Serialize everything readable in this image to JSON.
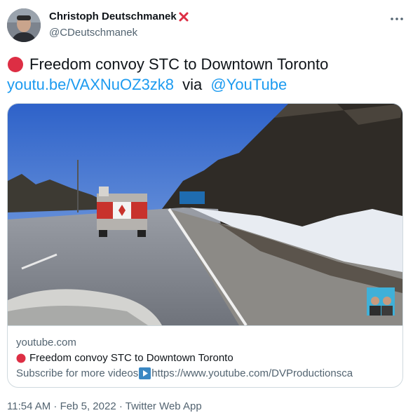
{
  "author": {
    "display_name": "Christoph Deutschmanek",
    "handle": "@CDeutschmanek",
    "name_emoji": "cross-mark-icon"
  },
  "tweet": {
    "line1_text": "Freedom convoy STC to Downtown Toronto",
    "link_text": "youtu.be/VAXNuOZ3zk8",
    "via_text": "via",
    "mention_text": "@YouTube"
  },
  "card": {
    "domain": "youtube.com",
    "title": "Freedom convoy STC to Downtown Toronto",
    "desc_prefix": "Subscribe for more videos",
    "desc_url": "https://www.youtube.com/DVProductionsca"
  },
  "meta": {
    "time": "11:54 AM",
    "date": "Feb 5, 2022",
    "source": "Twitter Web App",
    "separator": " · "
  },
  "colors": {
    "link": "#1d9bf0",
    "secondary_text": "#536471",
    "border": "#cfd9de",
    "red_circle": "#dd2e44"
  }
}
